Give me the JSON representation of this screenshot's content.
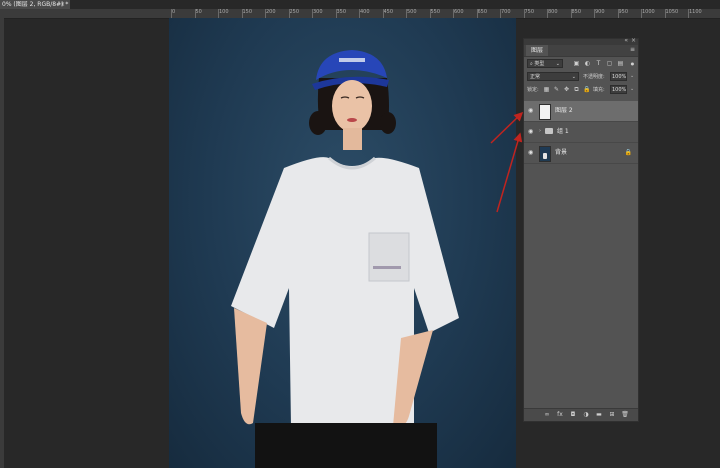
{
  "document": {
    "tab_title": "0% (图层 2, RGB/8#) *",
    "close_glyph": "×"
  },
  "ruler": {
    "ticks": [
      "0",
      "50",
      "100",
      "150",
      "200",
      "250",
      "300",
      "350",
      "400",
      "450",
      "500",
      "550",
      "600",
      "650",
      "700",
      "750",
      "800",
      "850",
      "900",
      "950",
      "1000",
      "1050",
      "1100",
      "1150",
      "1200"
    ]
  },
  "layers_panel": {
    "tab_label": "图层",
    "filter": {
      "kind_label": "类型",
      "icons": [
        "image-filter-icon",
        "adjustment-filter-icon",
        "type-filter-icon",
        "shape-filter-icon",
        "smart-object-filter-icon"
      ]
    },
    "blend": {
      "mode": "正常",
      "opacity_label": "不透明度:",
      "opacity_value": "100%"
    },
    "lock": {
      "label": "锁定:",
      "fill_label": "填充:",
      "fill_value": "100%"
    },
    "layers": [
      {
        "name": "图层 2",
        "selected": true,
        "kind": "layer"
      },
      {
        "name": "组 1",
        "selected": false,
        "kind": "group"
      },
      {
        "name": "背景",
        "selected": false,
        "kind": "background",
        "locked": true
      }
    ],
    "bottom_tools": [
      "link-layers-icon",
      "fx-icon",
      "add-mask-icon",
      "adjustment-layer-icon",
      "new-group-icon",
      "new-layer-icon",
      "delete-layer-icon"
    ]
  },
  "colors": {
    "canvas_bg": "#1f3a52",
    "cap": "#2746b8",
    "annotation_arrow": "#c0241f"
  }
}
